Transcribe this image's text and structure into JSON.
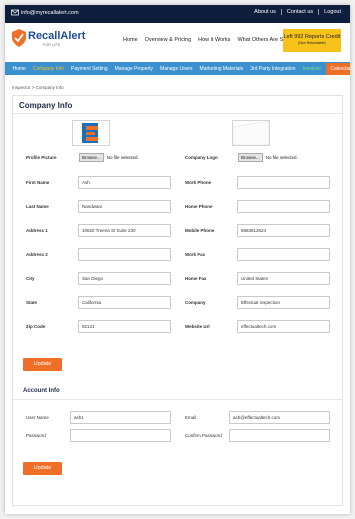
{
  "topbar": {
    "email": "info@myrecallalert.com",
    "links": [
      "About us",
      "Contact us",
      "Logout"
    ]
  },
  "header": {
    "logo_text": "RecallAlert",
    "logo_sub": "FOR LIFE",
    "nav": [
      "Home",
      "Overview & Pricing",
      "How it Works",
      "What Others Are Saying"
    ],
    "credit_line1": "Left 992 Reports Credit",
    "credit_line2": "(Non Refundable)"
  },
  "subnav": {
    "items": [
      "Home",
      "Company Info",
      "Payment Setting",
      "Manage Property",
      "Manage Users",
      "Marketing Materials",
      "3rd Party Integration",
      "Invoices",
      "Calendar"
    ]
  },
  "breadcrumb": "Inspector > Company Info",
  "company": {
    "title": "Company Info",
    "profile_picture_label": "Profile Picture",
    "company_logo_label": "Company Logo",
    "browse_label": "Browse...",
    "no_file": "No file selected.",
    "first_name_label": "First Name",
    "first_name": "Ash",
    "work_phone_label": "Work Phone",
    "work_phone": "",
    "last_name_label": "Last Name",
    "last_name": "Nandwani",
    "home_phone_label": "Home Phone",
    "home_phone": "",
    "address1_label": "Address 1",
    "address1": "10620 Treena St Suite 230",
    "mobile_phone_label": "Mobile Phone",
    "mobile_phone": "8583612624",
    "address2_label": "Address 2",
    "address2": "",
    "work_fax_label": "Work Fax",
    "work_fax": "",
    "city_label": "City",
    "city": "San Diego",
    "home_fax_label": "Home Fax",
    "home_fax": "United States",
    "state_label": "State",
    "state": "California",
    "company_label": "Company",
    "company_name": "Effectual inspection",
    "zip_label": "Zip Code",
    "zip": "92131",
    "website_label": "Website Url",
    "website": "effectualtech.com",
    "update_label": "Update"
  },
  "account": {
    "title": "Account Info",
    "user_name_label": "User Name",
    "user_name": "ash1",
    "email_label": "Email",
    "email": "ash@effectualtech.com",
    "password_label": "Password",
    "password": "",
    "confirm_password_label": "Confirm Password",
    "confirm_password": "",
    "update_label": "Update"
  }
}
